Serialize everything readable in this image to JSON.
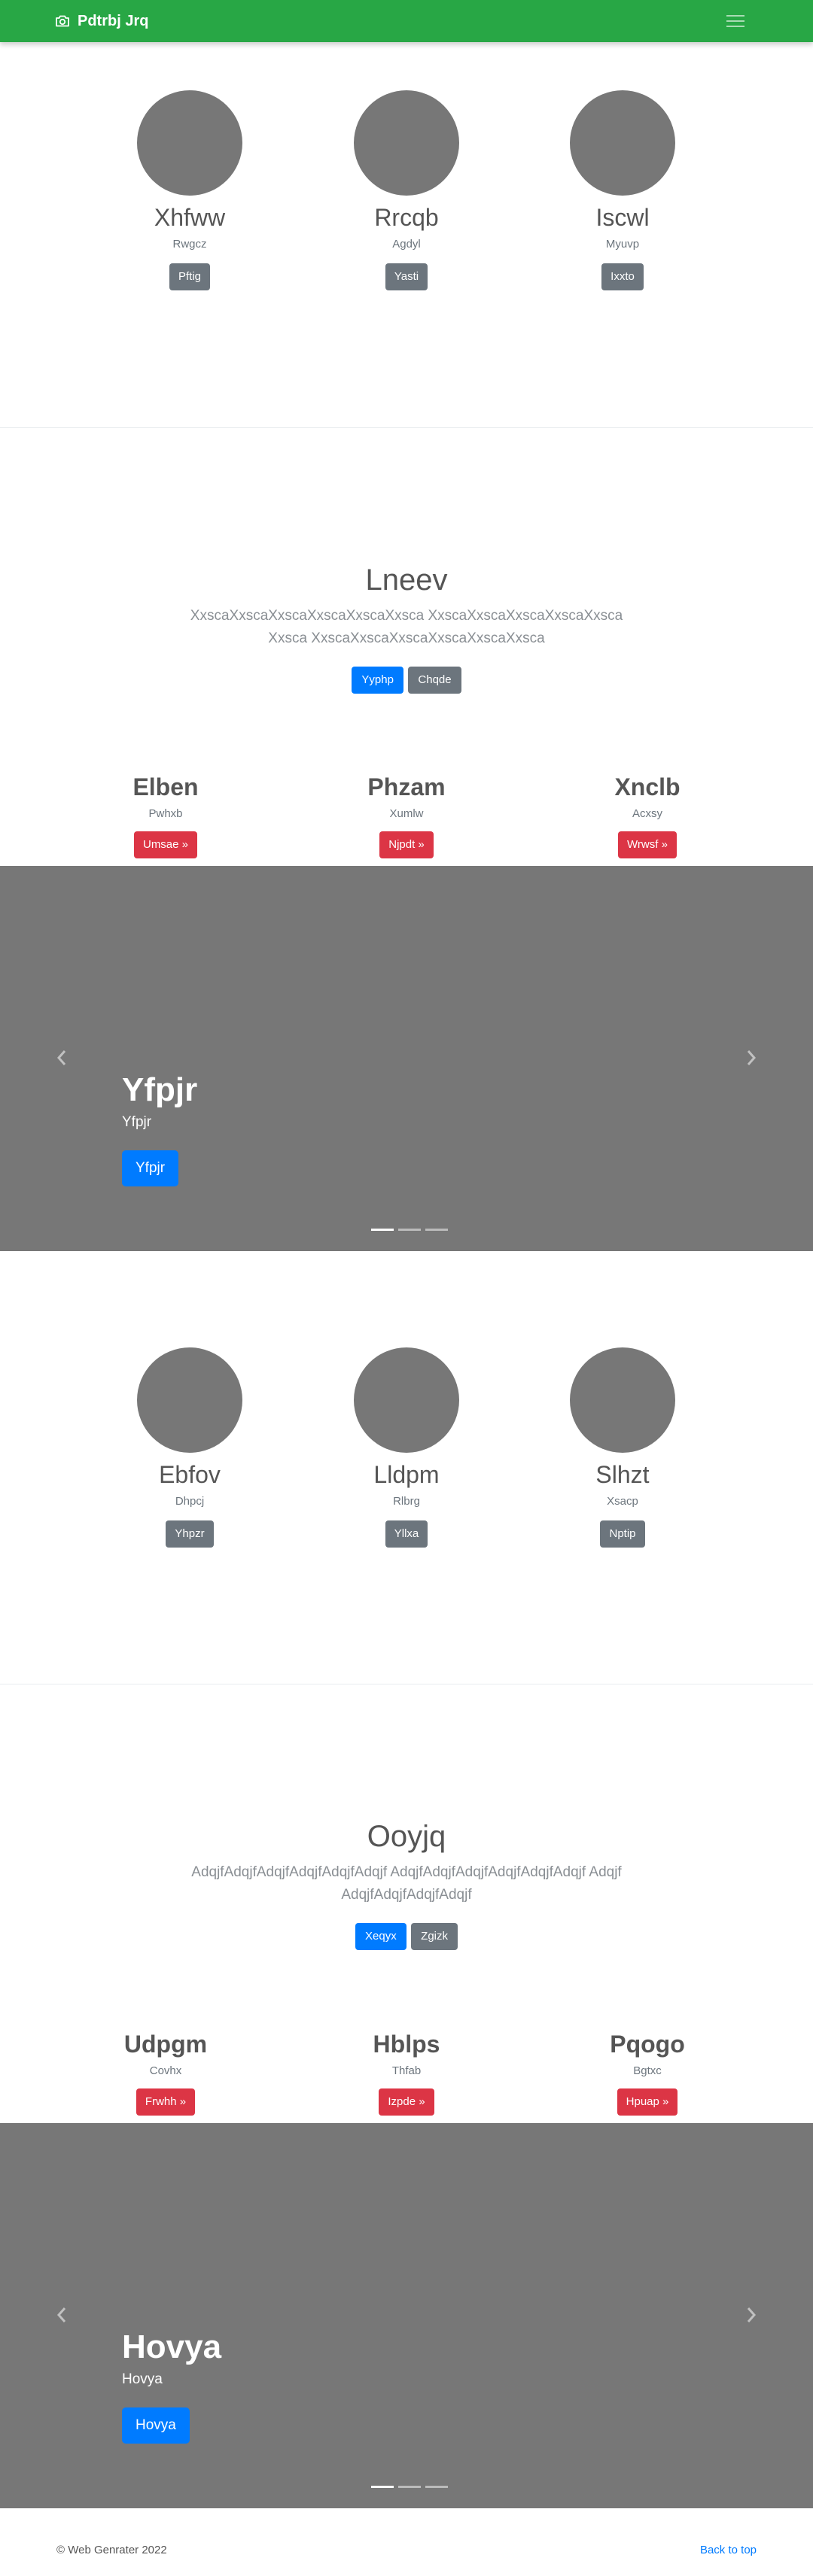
{
  "navbar": {
    "brand": "Pdtrbj Jrq",
    "brand_icon": "camera-icon",
    "toggle_icon": "hamburger-icon"
  },
  "profiles_1": [
    {
      "name": "Xhfww",
      "sub": "Rwgcz",
      "button": "Pftig"
    },
    {
      "name": "Rrcqb",
      "sub": "Agdyl",
      "button": "Yasti"
    },
    {
      "name": "Iscwl",
      "sub": "Myuvp",
      "button": "Ixxto"
    }
  ],
  "hero_1": {
    "title": "Lneev",
    "text": "XxscaXxscaXxscaXxscaXxscaXxsca XxscaXxscaXxscaXxscaXxscaXxsca XxscaXxscaXxscaXxscaXxscaXxsca",
    "primary": "Yyphp",
    "secondary": "Chqde"
  },
  "features_1": [
    {
      "title": "Elben",
      "sub": "Pwhxb",
      "button": "Umsae »"
    },
    {
      "title": "Phzam",
      "sub": "Xumlw",
      "button": "Njpdt »"
    },
    {
      "title": "Xnclb",
      "sub": "Acxsy",
      "button": "Wrwsf »"
    }
  ],
  "carousel_1": {
    "title": "Yfpjr",
    "sub": "Yfpjr",
    "button": "Yfpjr",
    "slides": 3,
    "active": 0
  },
  "profiles_2": [
    {
      "name": "Ebfov",
      "sub": "Dhpcj",
      "button": "Yhpzr"
    },
    {
      "name": "Lldpm",
      "sub": "Rlbrg",
      "button": "Yllxa"
    },
    {
      "name": "Slhzt",
      "sub": "Xsacp",
      "button": "Nptip"
    }
  ],
  "hero_2": {
    "title": "Ooyjq",
    "text": "AdqjfAdqjfAdqjfAdqjfAdqjfAdqjf AdqjfAdqjfAdqjfAdqjfAdqjfAdqjf AdqjfAdqjfAdqjfAdqjfAdqjf",
    "primary": "Xeqyx",
    "secondary": "Zgizk"
  },
  "features_2": [
    {
      "title": "Udpgm",
      "sub": "Covhx",
      "button": "Frwhh »"
    },
    {
      "title": "Hblps",
      "sub": "Thfab",
      "button": "Izpde »"
    },
    {
      "title": "Pqogo",
      "sub": "Bgtxc",
      "button": "Hpuap »"
    }
  ],
  "carousel_2": {
    "title": "Hovya",
    "sub": "Hovya",
    "button": "Hovya",
    "slides": 3,
    "active": 0
  },
  "footer": {
    "copyright": "© Web Genrater 2022",
    "back_to_top": "Back to top"
  },
  "colors": {
    "navbar": "#28a745",
    "primary": "#007bff",
    "secondary": "#6c757d",
    "danger": "#dc3545",
    "placeholder": "#777777"
  }
}
